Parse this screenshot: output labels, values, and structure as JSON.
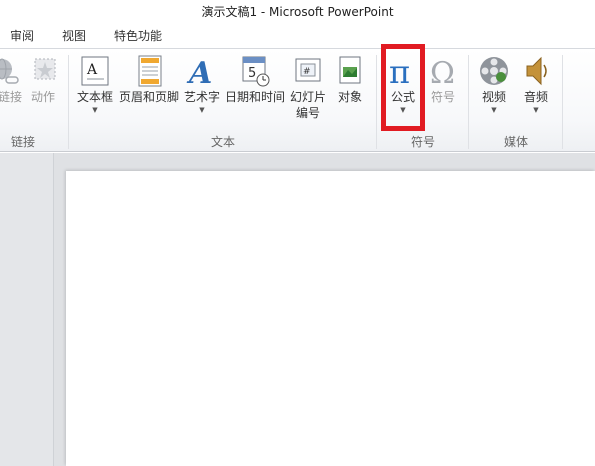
{
  "window": {
    "title": "演示文稿1 - Microsoft PowerPoint"
  },
  "tabs": [
    "审阅",
    "视图",
    "特色功能"
  ],
  "ribbon": {
    "links_group": {
      "label": "链接",
      "hyperlink": "链接",
      "action": "动作"
    },
    "text_group": {
      "label": "文本",
      "textbox": "文本框",
      "header_footer": "页眉和页脚",
      "wordart": "艺术字",
      "datetime": "日期和时间",
      "slide_number_line1": "幻灯片",
      "slide_number_line2": "编号",
      "object": "对象"
    },
    "symbols_group": {
      "label": "符号",
      "equation": "公式",
      "symbol": "符号"
    },
    "media_group": {
      "label": "媒体",
      "video": "视频",
      "audio": "音频"
    }
  },
  "colors": {
    "highlight": "#e11b22",
    "pi_blue": "#2a6fbf"
  }
}
